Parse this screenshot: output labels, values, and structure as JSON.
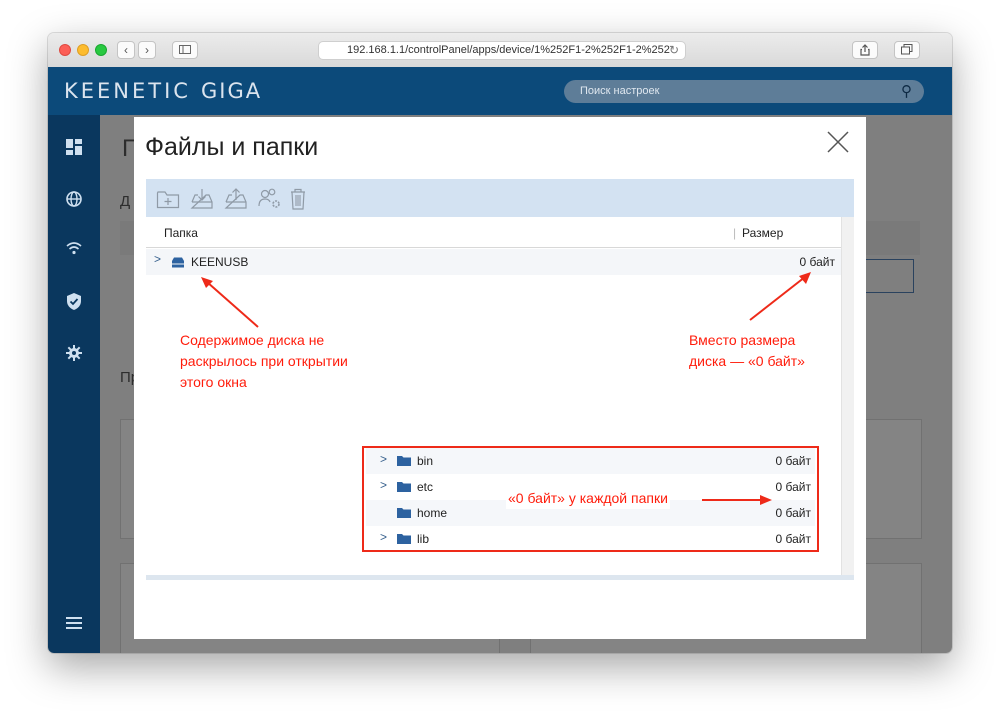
{
  "browser": {
    "url": "192.168.1.1/controlPanel/apps/device/1%252F1-2%252F1-2%252",
    "new_tab_label": "+"
  },
  "header": {
    "logo_brand": "KEENETIC",
    "logo_model": "GIGA",
    "search_placeholder": "Поиск настроек"
  },
  "background_page": {
    "title_partial": "Г",
    "section_partial": "Д",
    "section2_partial": "Пр"
  },
  "modal": {
    "title": "Файлы и папки",
    "toolbar_tools": [
      "new-folder-icon",
      "download-icon",
      "upload-icon",
      "permissions-icon",
      "trash-icon"
    ],
    "columns": {
      "folder": "Папка",
      "size": "Размер"
    },
    "drive": {
      "name": "KEENUSB",
      "size": "0 байт"
    },
    "folders": [
      {
        "name": "bin",
        "size": "0 байт",
        "expandable": true
      },
      {
        "name": "etc",
        "size": "0 байт",
        "expandable": true
      },
      {
        "name": "home",
        "size": "0 байт",
        "expandable": false
      },
      {
        "name": "lib",
        "size": "0 байт",
        "expandable": true
      }
    ]
  },
  "annotations": {
    "drive_contents": [
      "Содержимое диска не",
      "раскрылось при открытии",
      "этого окна"
    ],
    "drive_size": [
      "Вместо размера",
      "диска — «0 байт»"
    ],
    "folders_size": "«0 байт» у каждой папки",
    "color": "#ff1c0b"
  },
  "colors": {
    "topbar": "#0c4a7a",
    "sidebar": "#0a375e",
    "toolbar": "#d3e2f2",
    "folder_icon": "#2d62a0"
  }
}
